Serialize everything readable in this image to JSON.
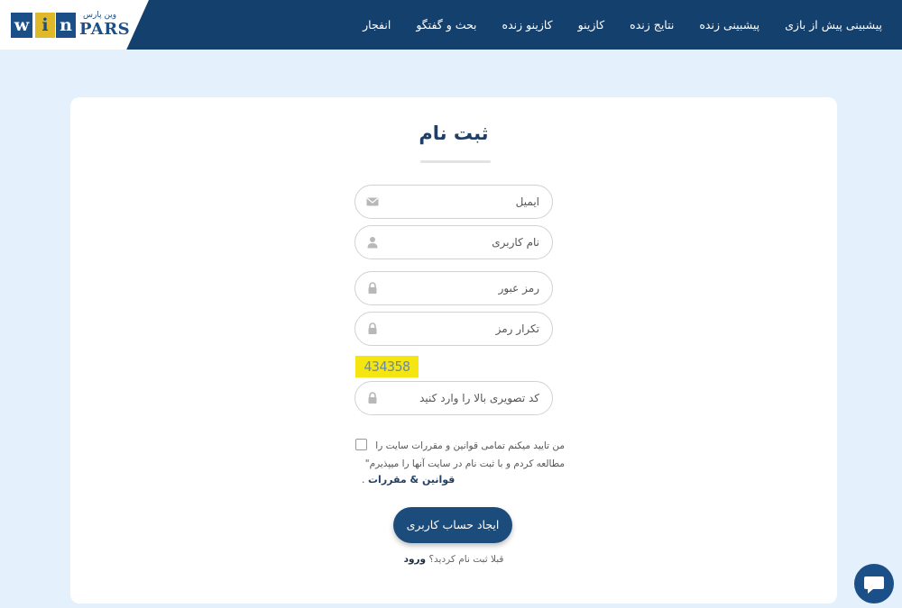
{
  "header": {
    "logo": {
      "letters": [
        "w",
        "i",
        "n"
      ],
      "pars": "PARS",
      "sub": "وین پارس"
    },
    "nav": [
      "پیشبینی پیش از بازی",
      "پیشبینی زنده",
      "نتایج زنده",
      "کازینو",
      "کازینو زنده",
      "بحث و گفتگو",
      "انفجار"
    ]
  },
  "form": {
    "title": "ثبت نام",
    "fields": {
      "email": {
        "placeholder": "ایمیل",
        "icon": "envelope-icon"
      },
      "username": {
        "placeholder": "نام کاربری",
        "icon": "user-icon"
      },
      "password": {
        "placeholder": "رمز عبور",
        "icon": "lock-icon"
      },
      "password_repeat": {
        "placeholder": "تکرار رمز",
        "icon": "lock-icon"
      },
      "captcha_input": {
        "placeholder": "کد تصویری بالا را وارد کنید",
        "icon": "lock-icon"
      }
    },
    "captcha_code": "434358",
    "terms_text": "من تایید میکنم تمامی قوانین و مقررات سایت را مطالعه کردم و با ثبت نام در سایت آنها را میپذیرم\"",
    "terms_link": "قوانین & مقررات",
    "terms_dot": ".",
    "submit_label": "ایجاد حساب کاربری",
    "login_prompt": "قبلا ثبت نام کردید؟",
    "login_link": "ورود"
  },
  "colors": {
    "header_bg": "#14406d",
    "page_bg": "#e4f0fb",
    "button_bg": "#1c4c7c",
    "captcha_bg": "#f5e611"
  },
  "chat": {
    "icon": "chat-bubble-icon"
  }
}
